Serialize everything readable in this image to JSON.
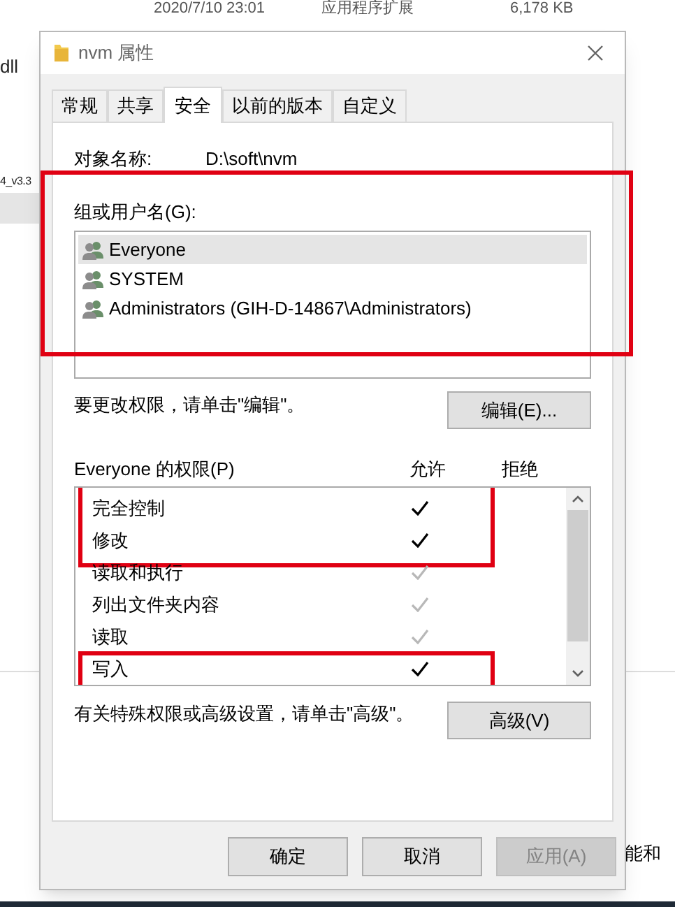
{
  "background": {
    "file_row": {
      "date": "2020/7/10 23:01",
      "type": "应用程序扩展",
      "size": "6,178 KB"
    },
    "left_texts": [
      "dll",
      "4_v3.3"
    ],
    "right_text": "能和"
  },
  "window": {
    "title": "nvm 属性"
  },
  "tabs": [
    {
      "label": "常规",
      "selected": false
    },
    {
      "label": "共享",
      "selected": false
    },
    {
      "label": "安全",
      "selected": true
    },
    {
      "label": "以前的版本",
      "selected": false
    },
    {
      "label": "自定义",
      "selected": false
    }
  ],
  "object_name": {
    "label": "对象名称:",
    "value": "D:\\soft\\nvm"
  },
  "groups": {
    "label": "组或用户名(G):",
    "highlighted": true,
    "items": [
      {
        "name": "Everyone",
        "selected": true
      },
      {
        "name": "SYSTEM",
        "selected": false
      },
      {
        "name": "Administrators (GIH-D-14867\\Administrators)",
        "selected": false
      }
    ]
  },
  "edit_hint": "要更改权限，请单击\"编辑\"。",
  "edit_button": "编辑(E)...",
  "permissions": {
    "label": "Everyone 的权限(P)",
    "allow_header": "允许",
    "deny_header": "拒绝",
    "rows": [
      {
        "name": "完全控制",
        "allowed": true,
        "inherited": false,
        "highlighted": true
      },
      {
        "name": "修改",
        "allowed": true,
        "inherited": false,
        "highlighted": true
      },
      {
        "name": "读取和执行",
        "allowed": true,
        "inherited": true,
        "highlighted": false
      },
      {
        "name": "列出文件夹内容",
        "allowed": true,
        "inherited": true,
        "highlighted": false
      },
      {
        "name": "读取",
        "allowed": true,
        "inherited": true,
        "highlighted": false
      },
      {
        "name": "写入",
        "allowed": true,
        "inherited": false,
        "highlighted": true
      }
    ]
  },
  "advanced_hint": "有关特殊权限或高级设置，请单击\"高级\"。",
  "advanced_button": "高级(V)",
  "buttons": [
    {
      "label": "确定",
      "disabled": false
    },
    {
      "label": "取消",
      "disabled": false
    },
    {
      "label": "应用(A)",
      "disabled": true
    }
  ]
}
